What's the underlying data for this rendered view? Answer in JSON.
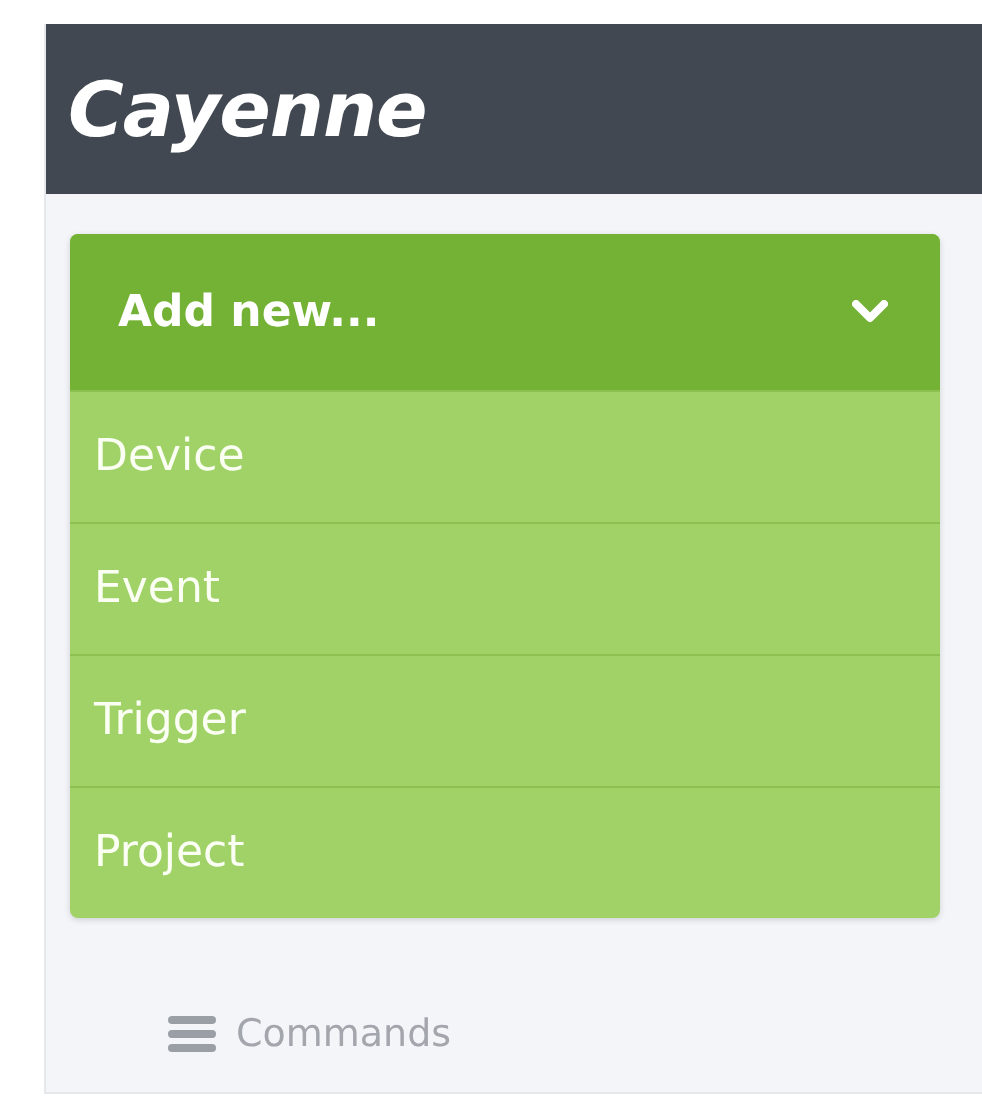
{
  "app": {
    "title": "Cayenne"
  },
  "add_menu": {
    "label": "Add new...",
    "expanded": true,
    "items": [
      {
        "label": "Device"
      },
      {
        "label": "Event"
      },
      {
        "label": "Trigger"
      },
      {
        "label": "Project"
      }
    ]
  },
  "sidebar": {
    "items": [
      {
        "label": "Commands"
      }
    ]
  }
}
